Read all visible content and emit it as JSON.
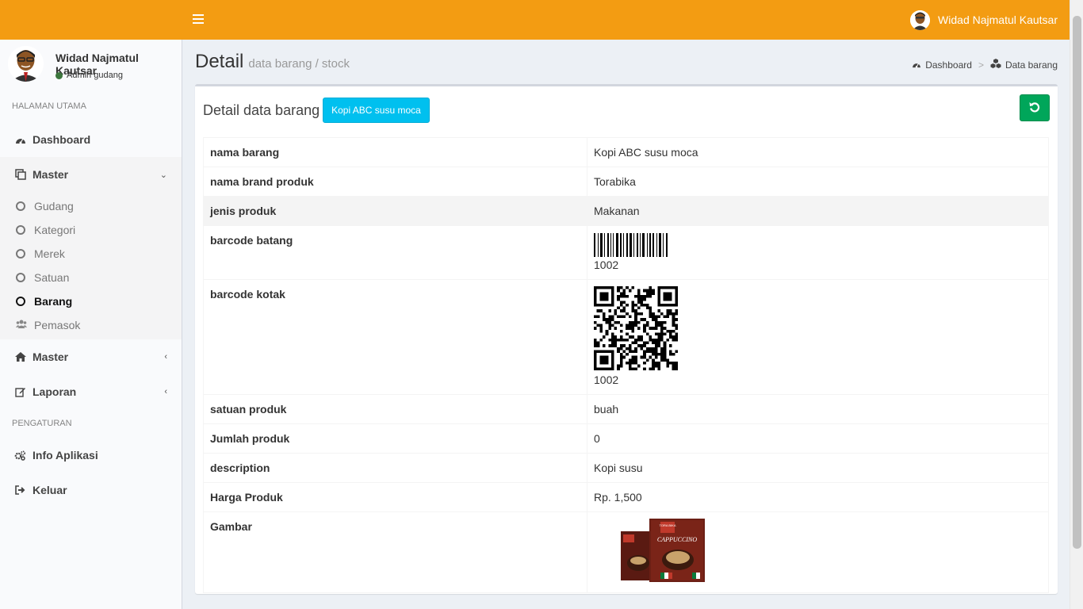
{
  "user": {
    "name": "Widad Najmatul Kautsar",
    "role": "Admin gudang"
  },
  "sidebar": {
    "section_main": "HALAMAN UTAMA",
    "dashboard": "Dashboard",
    "master": "Master",
    "sub_items": [
      "Gudang",
      "Kategori",
      "Merek",
      "Satuan",
      "Barang",
      "Pemasok"
    ],
    "master2": "Master",
    "laporan": "Laporan",
    "section_settings": "PENGATURAN",
    "info": "Info Aplikasi",
    "logout": "Keluar"
  },
  "header": {
    "title": "Detail",
    "subtitle": "data barang / stock"
  },
  "breadcrumb": {
    "home": "Dashboard",
    "current": "Data barang"
  },
  "box": {
    "title": "Detail data barang",
    "label": "Kopi ABC susu moca"
  },
  "details": {
    "nama_barang": {
      "key": "nama barang",
      "value": "Kopi ABC susu moca"
    },
    "brand": {
      "key": "nama brand produk",
      "value": "Torabika"
    },
    "jenis": {
      "key": "jenis produk",
      "value": "Makanan"
    },
    "barcode_batang": {
      "key": "barcode batang",
      "value": "1002"
    },
    "barcode_kotak": {
      "key": "barcode kotak",
      "value": "1002"
    },
    "satuan": {
      "key": "satuan produk",
      "value": "buah"
    },
    "jumlah": {
      "key": "Jumlah produk",
      "value": "0"
    },
    "description": {
      "key": "description",
      "value": "Kopi susu"
    },
    "harga": {
      "key": "Harga Produk",
      "value": "Rp. 1,500"
    },
    "gambar": {
      "key": "Gambar"
    }
  },
  "product_image_text": {
    "brand": "TORA BIKA",
    "name": "CAPPUCCINO"
  },
  "colors": {
    "topbar": "#f39c12",
    "label": "#00c0ef",
    "refresh": "#00a65a",
    "status": "#3c763d"
  },
  "icons": [
    "menu-icon",
    "dashboard-icon",
    "copy-icon",
    "home-icon",
    "edit-icon",
    "cogs-icon",
    "sign-out-icon",
    "refresh-icon",
    "users-icon",
    "cubes-icon"
  ]
}
